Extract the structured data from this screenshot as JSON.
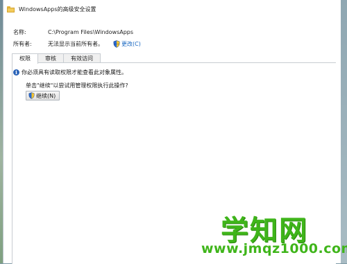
{
  "window": {
    "title": "WindowsApps的高级安全设置"
  },
  "fields": {
    "name_label": "名称:",
    "name_value": "C:\\Program Files\\WindowsApps",
    "owner_label": "所有者:",
    "owner_value": "无法显示当前所有者。",
    "change_link": "更改(C)"
  },
  "tabs": [
    {
      "label": "权限",
      "active": true
    },
    {
      "label": "审核",
      "active": false
    },
    {
      "label": "有效访问",
      "active": false
    }
  ],
  "permissions": {
    "info_message": "你必须具有读取权限才能查看此对象属性。",
    "hint_text": "单击\"继续\"以尝试用管理权限执行此操作?",
    "continue_button": "继续(N)"
  },
  "watermark": {
    "main": "学知网",
    "url": "www.jmqz1000.com"
  },
  "colors": {
    "link": "#1565c0",
    "info_icon": "#2a63b8",
    "watermark": "#3fb51a"
  }
}
